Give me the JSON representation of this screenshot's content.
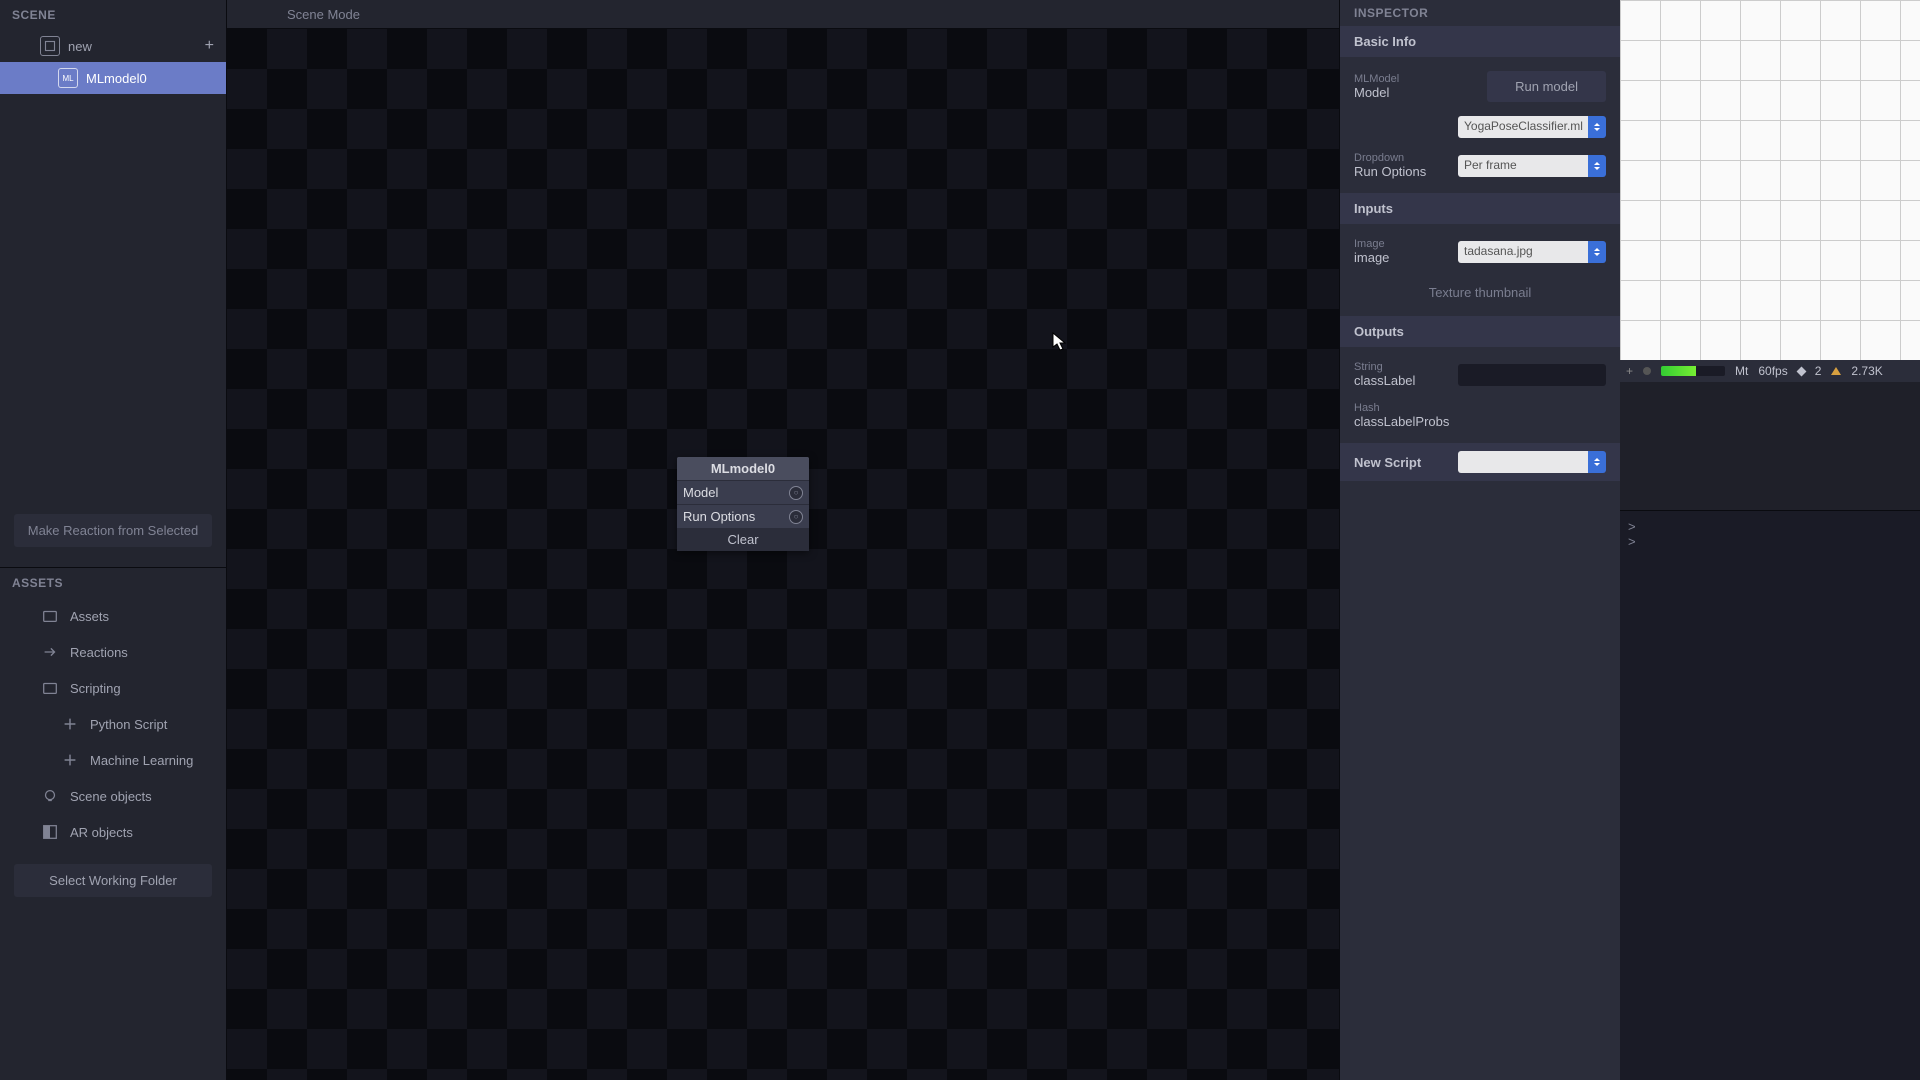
{
  "scene": {
    "header": "SCENE",
    "root_name": "new",
    "selected_node": "MLmodel0",
    "make_reaction_label": "Make Reaction from Selected"
  },
  "assets": {
    "header": "ASSETS",
    "items": [
      "Assets",
      "Reactions",
      "Scripting"
    ],
    "script_children": [
      "Python Script",
      "Machine Learning"
    ],
    "tail_items": [
      "Scene objects",
      "AR objects"
    ],
    "select_folder_label": "Select Working Folder"
  },
  "viewport": {
    "mode_label": "Scene Mode",
    "node": {
      "title": "MLmodel0",
      "rows": [
        "Model",
        "Run Options"
      ],
      "clear": "Clear"
    }
  },
  "inspector": {
    "title": "INSPECTOR",
    "basic_info": "Basic Info",
    "model_section": {
      "type_label": "MLModel",
      "name_label": "Model",
      "run_button": "Run model",
      "model_file": "YogaPoseClassifier.ml"
    },
    "run_options": {
      "type_label": "Dropdown",
      "name_label": "Run Options",
      "value": "Per frame"
    },
    "inputs_header": "Inputs",
    "image_input": {
      "type_label": "Image",
      "name_label": "image",
      "value": "tadasana.jpg",
      "thumb_label": "Texture thumbnail"
    },
    "outputs_header": "Outputs",
    "class_label": {
      "type_label": "String",
      "name_label": "classLabel"
    },
    "class_probs": {
      "type_label": "Hash",
      "name_label": "classLabelProbs"
    },
    "new_script_label": "New Script"
  },
  "status": {
    "mt": "Mt",
    "fps": "60fps",
    "count": "2",
    "verts": "2.73K"
  },
  "console": {
    "lines": [
      ">",
      ">"
    ]
  }
}
